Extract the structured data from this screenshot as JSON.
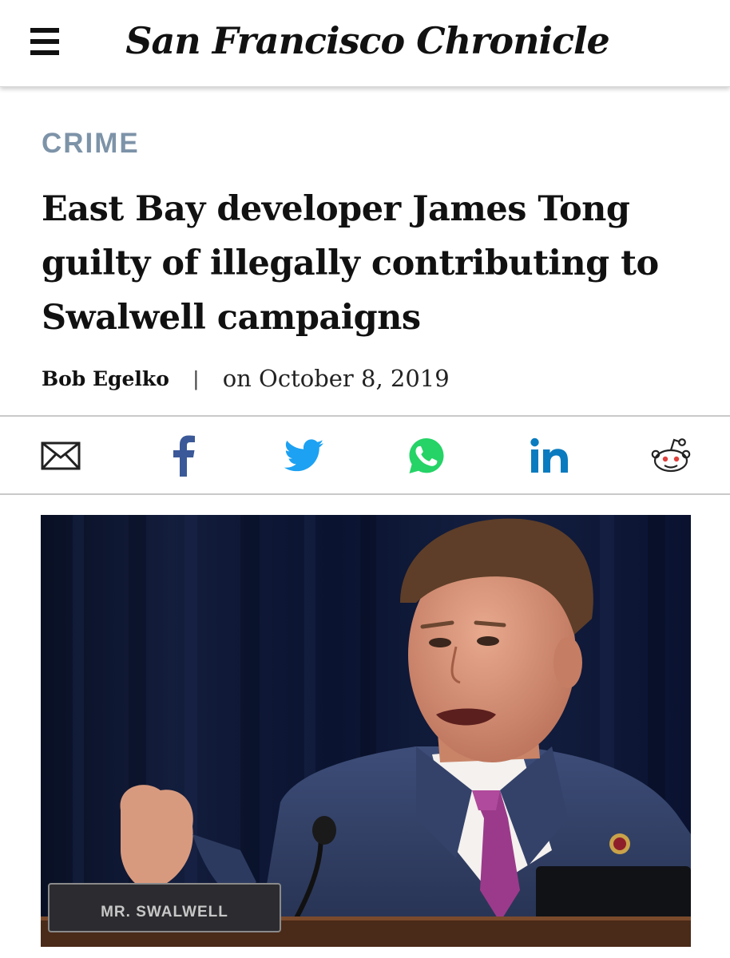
{
  "header": {
    "menu_icon": "hamburger-menu-icon",
    "masthead": "San Francisco Chronicle"
  },
  "article": {
    "section": "CRIME",
    "headline": "East Bay developer James Tong guilty of illegally contributing to Swalwell campaigns",
    "author": "Bob Egelko",
    "separator": "|",
    "date": "on October 8, 2019"
  },
  "share": [
    {
      "name": "email",
      "icon": "envelope-icon",
      "color": "#222222"
    },
    {
      "name": "facebook",
      "icon": "facebook-icon",
      "color": "#3b5998"
    },
    {
      "name": "twitter",
      "icon": "twitter-bird-icon",
      "color": "#1da1f2"
    },
    {
      "name": "whatsapp",
      "icon": "whatsapp-icon",
      "color": "#25d366"
    },
    {
      "name": "linkedin",
      "icon": "linkedin-icon",
      "color": "#0a7bbf"
    },
    {
      "name": "reddit",
      "icon": "reddit-alien-icon",
      "color": "#222222"
    }
  ],
  "photo": {
    "nameplate": "MR. SWALWELL"
  },
  "colors": {
    "section_accent": "#7d93a8",
    "background": "#ffffff",
    "curtain": "#0b1226"
  }
}
